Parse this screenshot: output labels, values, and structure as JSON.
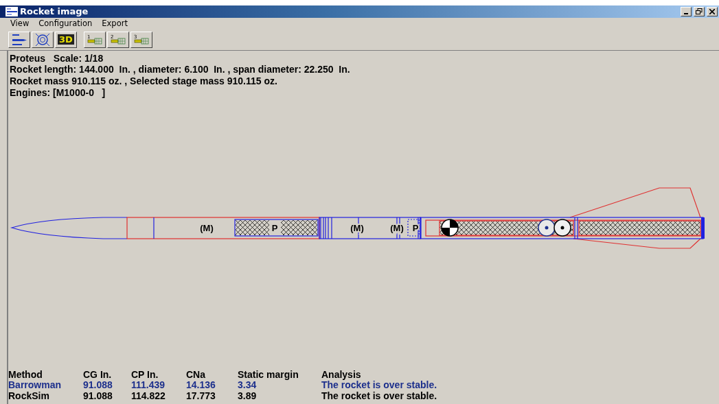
{
  "window": {
    "title": "Rocket image"
  },
  "menu": [
    "View",
    "Configuration",
    "Export"
  ],
  "toolbar": [
    {
      "kind": "rocket"
    },
    {
      "kind": "target"
    },
    {
      "kind": "text",
      "label": "3D"
    },
    {
      "kind": "stage",
      "label": "1"
    },
    {
      "kind": "stage",
      "label": "2"
    },
    {
      "kind": "stage",
      "label": "3"
    }
  ],
  "info": [
    "Proteus   Scale: 1/18",
    "Rocket length: 144.000  In. , diameter: 6.100  In. , span diameter: 22.250  In.",
    "Rocket mass 910.115 oz. , Selected stage mass 910.115 oz.",
    "Engines: [M1000-0   ]"
  ],
  "rocket": {
    "labels": [
      "(M)",
      "P",
      "(M)",
      "(M)",
      "P"
    ]
  },
  "table": {
    "columns": [
      "Method",
      "CG In.",
      "CP In.",
      "CNa",
      "Static margin",
      "Analysis"
    ],
    "rows": [
      {
        "cells": [
          "Barrowman",
          "91.088",
          "111.439",
          "14.136",
          "3.34",
          "The rocket is over stable."
        ],
        "color": "#1c2f8c"
      },
      {
        "cells": [
          "RockSim",
          "91.088",
          "114.822",
          "17.773",
          "3.89",
          "The rocket is over stable."
        ],
        "color": "#000000"
      }
    ]
  }
}
